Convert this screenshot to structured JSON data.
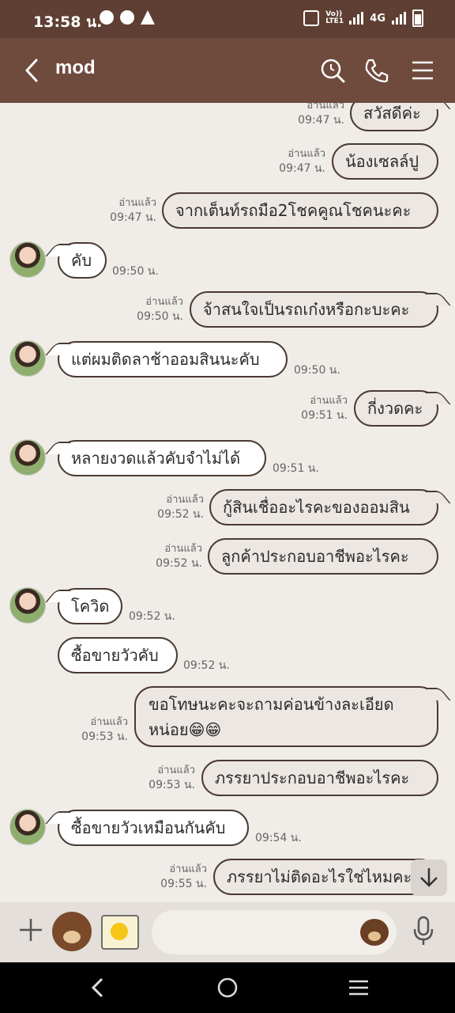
{
  "status_bar": {
    "time": "13:58 น.",
    "volte": "Vo)) LTE1",
    "network": "4G"
  },
  "header": {
    "title": "mod"
  },
  "messages": [
    {
      "dir": "out",
      "text": "สวัสดีค่ะ",
      "read": "อ่านแล้ว",
      "time": "09:47 น."
    },
    {
      "dir": "out",
      "text": "น้องเซลล์ปู",
      "read": "อ่านแล้ว",
      "time": "09:47 น."
    },
    {
      "dir": "out",
      "text": "จากเต็นท์รถมือ2โชคคูณโชคนะคะ",
      "read": "อ่านแล้ว",
      "time": "09:47 น."
    },
    {
      "dir": "in",
      "text": "คับ",
      "time": "09:50 น."
    },
    {
      "dir": "out",
      "text": "จ้าสนใจเป็นรถเก๋งหรือกะบะคะ",
      "read": "อ่านแล้ว",
      "time": "09:50 น."
    },
    {
      "dir": "in",
      "text": "แต่ผมติดลาช้าออมสินนะคับ",
      "time": "09:50 น."
    },
    {
      "dir": "out",
      "text": "กี่งวดคะ",
      "read": "อ่านแล้ว",
      "time": "09:51 น."
    },
    {
      "dir": "in",
      "text": "หลายงวดแล้วคับจำไม่ได้",
      "time": "09:51 น."
    },
    {
      "dir": "out",
      "text": "กู้สินเชื่ออะไรคะของออมสิน",
      "read": "อ่านแล้ว",
      "time": "09:52 น."
    },
    {
      "dir": "out",
      "text": "ลูกค้าประกอบอาชีพอะไรคะ",
      "read": "อ่านแล้ว",
      "time": "09:52 น."
    },
    {
      "dir": "in",
      "text": "โควิด",
      "time": "09:52 น."
    },
    {
      "dir": "in",
      "text": "ซื้อขายวัวคับ",
      "time": "09:52 น."
    },
    {
      "dir": "out",
      "text": "ขอโทษนะคะจะถามค่อนข้างละเอียดหน่อย😁😁",
      "read": "อ่านแล้ว",
      "time": "09:53 น."
    },
    {
      "dir": "out",
      "text": "ภรรยาประกอบอาชีพอะไรคะ",
      "read": "อ่านแล้ว",
      "time": "09:53 น."
    },
    {
      "dir": "in",
      "text": "ซื้อขายวัวเหมือนกันคับ",
      "time": "09:54 น."
    },
    {
      "dir": "out",
      "text": "ภรรยาไม่ติดอะไรใช่ไหมคะ",
      "read": "อ่านแล้ว",
      "time": "09:55 น."
    }
  ],
  "composer": {
    "placeholder": ""
  },
  "colors": {
    "header_bg": "#6f4b3e",
    "status_bg": "#5f3f33",
    "chat_bg": "#f0ece7",
    "bubble_border": "#4a3a33"
  }
}
